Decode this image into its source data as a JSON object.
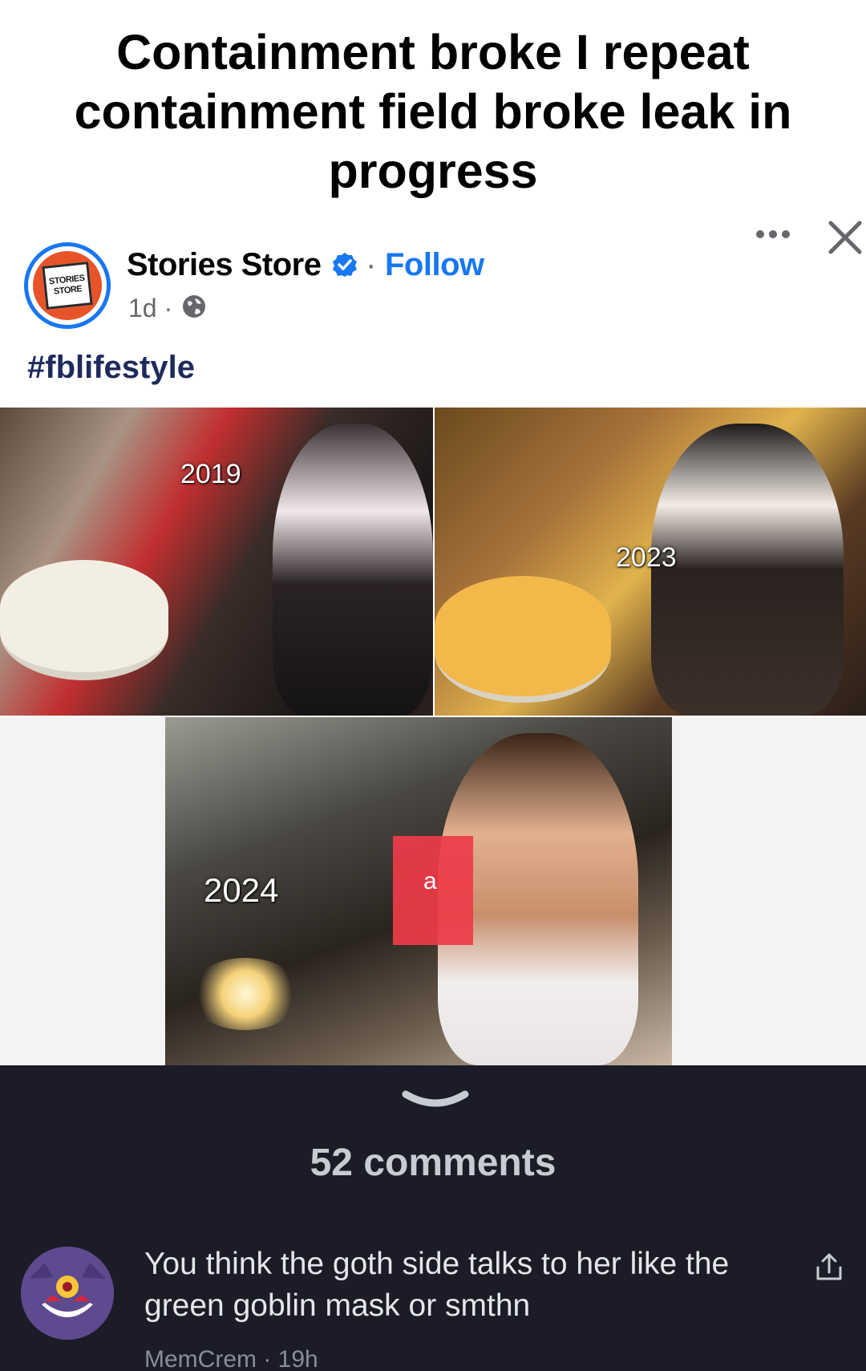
{
  "caption": {
    "line1": "Containment broke I repeat",
    "line2": "containment field broke leak in",
    "line3": "progress"
  },
  "post": {
    "avatar_text_1": "STORIES",
    "avatar_text_2": "STORE",
    "page_name": "Stories Store",
    "separator": "·",
    "follow_label": "Follow",
    "time": "1d ·",
    "hashtag": "#fblifestyle",
    "more_icon": "more-dots-icon",
    "close_icon": "close-icon",
    "verified_icon": "verified-badge-icon",
    "audience_icon": "globe-icon",
    "accent_color": "#1877f2"
  },
  "photos": {
    "label_2019": "2019",
    "label_2023": "2023",
    "label_2024": "2024",
    "overlay_letter": "a"
  },
  "comments": {
    "count_label": "52 comments",
    "first": {
      "text": "You think the goth side talks to her like the green goblin mask or smthn",
      "meta": "MemCrem · 19h"
    },
    "share_icon": "share-icon",
    "panel_color": "#1c1c28"
  }
}
